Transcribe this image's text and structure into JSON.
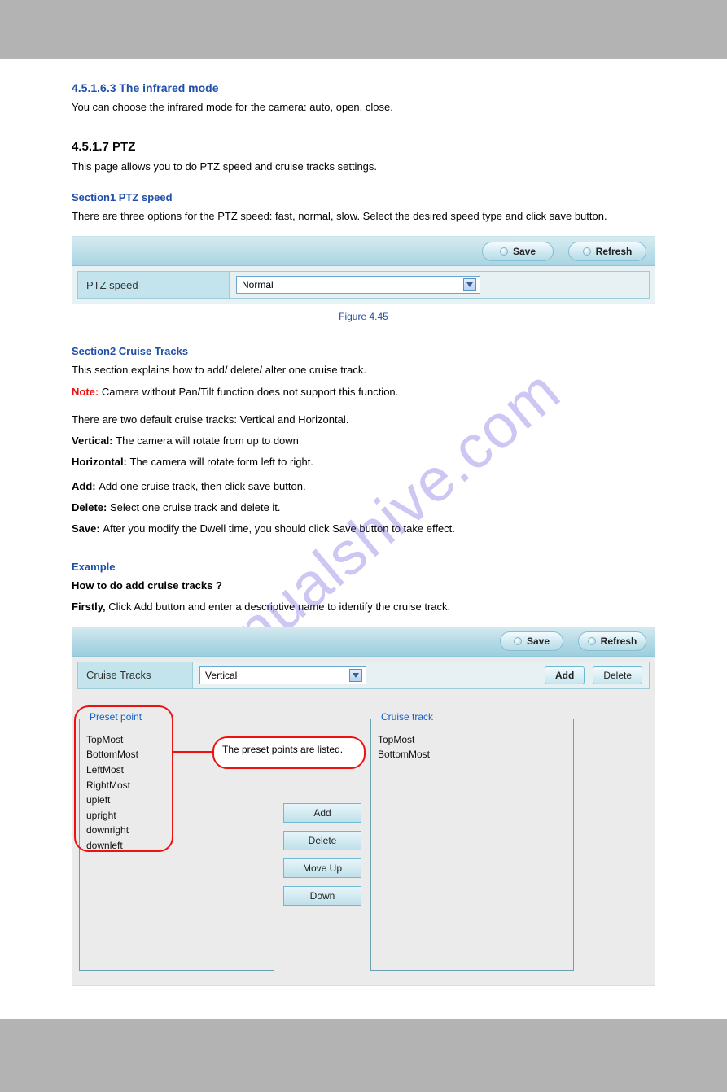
{
  "watermark": "manualshive.com",
  "sec1": {
    "title": "4.5.1.6.3 The infrared mode",
    "intro": "You can choose the infrared mode for the camera: auto, open, close.",
    "deep_title": "4.5.1.7 PTZ",
    "speed_intro": "This page allows you to do PTZ speed and cruise tracks settings."
  },
  "sec2_title": "Section1 PTZ speed",
  "sec2_para": "There are three options for the PTZ speed: fast, normal, slow. Select the desired speed type and click save button.",
  "panel1": {
    "save_btn": "Save",
    "refresh_btn": "Refresh",
    "row_label": "PTZ speed",
    "select_value": "Normal",
    "figcap": "Figure 4.45"
  },
  "sec3": {
    "title": "Section2 Cruise Tracks",
    "para": "This section explains how to add/ delete/ alter one cruise track.",
    "note_label": "Note:",
    "note_body": " Camera without Pan/Tilt function does not support this function.",
    "para2": "There are two default cruise tracks: Vertical and Horizontal.",
    "vert_label": "Vertical: ",
    "vert_body": "The camera will rotate from up to down",
    "horz_label": "Horizontal: ",
    "horz_body": "The camera will rotate form left to right.",
    "add_label": "Add: ",
    "add_body": "Add one cruise track, then click save button.",
    "del_label": "Delete: ",
    "del_body": "Select one cruise track and delete it.",
    "save_label": "Save: ",
    "save_body": "After you modify the Dwell time, you should click Save button to take effect.",
    "example_title": "Example",
    "example_head": "How to do add cruise tracks ?",
    "step1_label": "Firstly, ",
    "step1_body": "Click Add button and enter a descriptive name to identify the cruise track."
  },
  "panel2": {
    "save_btn": "Save",
    "refresh_btn": "Refresh",
    "row_label": "Cruise Tracks",
    "select_value": "Vertical",
    "add_btn": "Add",
    "delete_btn": "Delete",
    "preset_legend": "Preset point",
    "cruise_legend": "Cruise track",
    "actions": {
      "add": "Add",
      "delete": "Delete",
      "moveup": "Move Up",
      "down": "Down"
    },
    "preset_items": [
      "TopMost",
      "BottomMost",
      "LeftMost",
      "RightMost",
      "upleft",
      "upright",
      "downright",
      "downleft"
    ],
    "cruise_items": [
      "TopMost",
      "BottomMost"
    ],
    "callout": "The preset points are listed."
  }
}
